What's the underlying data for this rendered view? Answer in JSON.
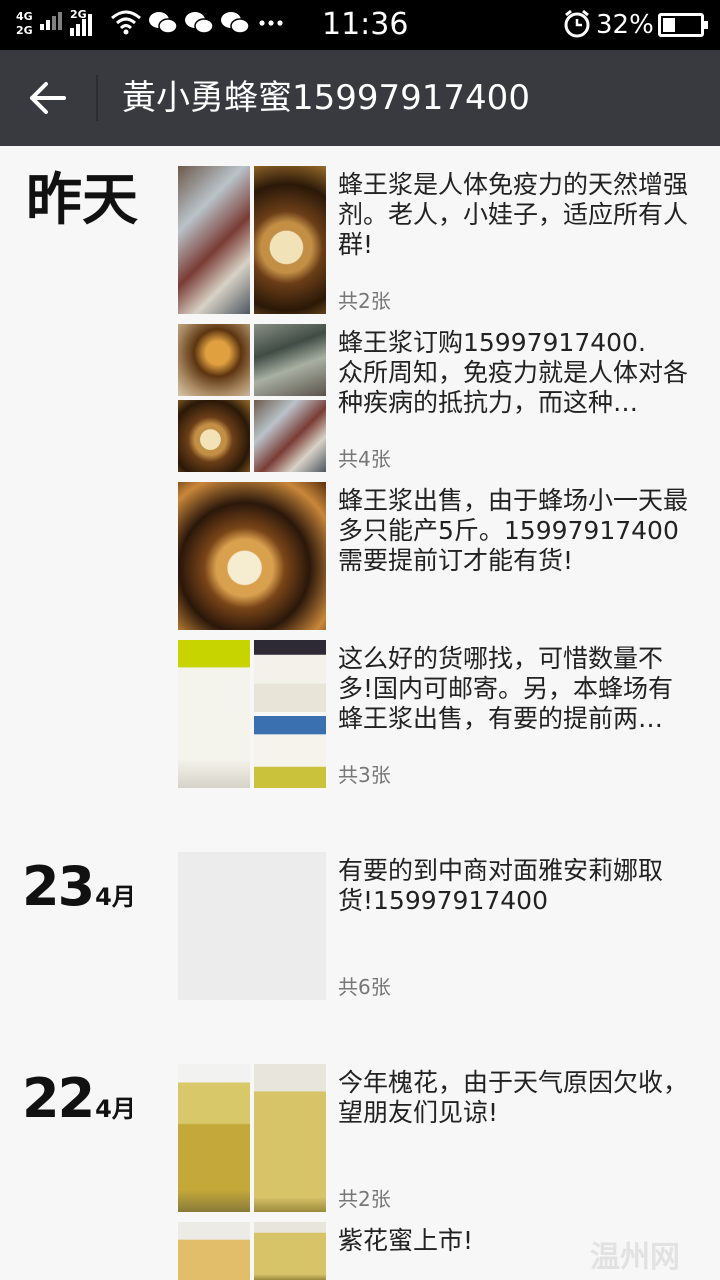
{
  "status_bar": {
    "net_top": "4G",
    "net_bottom": "2G",
    "net2": "2G",
    "time": "11:36",
    "battery_pct": "32%",
    "battery_level": 0.32,
    "icons": [
      "signal-icon",
      "wifi-icon",
      "wechat-icon",
      "wechat-icon",
      "wechat-icon",
      "more-dots-icon",
      "alarm-icon",
      "battery-icon"
    ]
  },
  "header": {
    "title": "黃小勇蜂蜜15997917400",
    "back_icon": "arrow-left-icon"
  },
  "groups": [
    {
      "date_label": "昨天",
      "posts": [
        {
          "text": "蜂王浆是人体免疫力的天然增强剂。老人，小娃子，适应所有人群!",
          "count": "共2张"
        },
        {
          "text": "蜂王浆订购15997917400.\n众所周知，免疫力就是人体对各种疾病的抵抗力，而这种…",
          "count": "共4张"
        },
        {
          "text": "蜂王浆出售，由于蜂场小一天最多只能产5斤。15997917400需要提前订才能有货!",
          "count": ""
        },
        {
          "text": "这么好的货哪找，可惜数量不多!国内可邮寄。另，本蜂场有蜂王浆出售，有要的提前两…",
          "count": "共3张"
        }
      ]
    },
    {
      "day": "23",
      "month": "4月",
      "posts": [
        {
          "text": "有要的到中商对面雅安莉娜取货!15997917400",
          "count": "共6张"
        }
      ]
    },
    {
      "day": "22",
      "month": "4月",
      "posts": [
        {
          "text": "今年槐花，由于天气原因欠收，望朋友们见谅!",
          "count": "共2张"
        },
        {
          "text": "紫花蜜上市!",
          "count": ""
        }
      ]
    }
  ],
  "watermark": "温州网"
}
